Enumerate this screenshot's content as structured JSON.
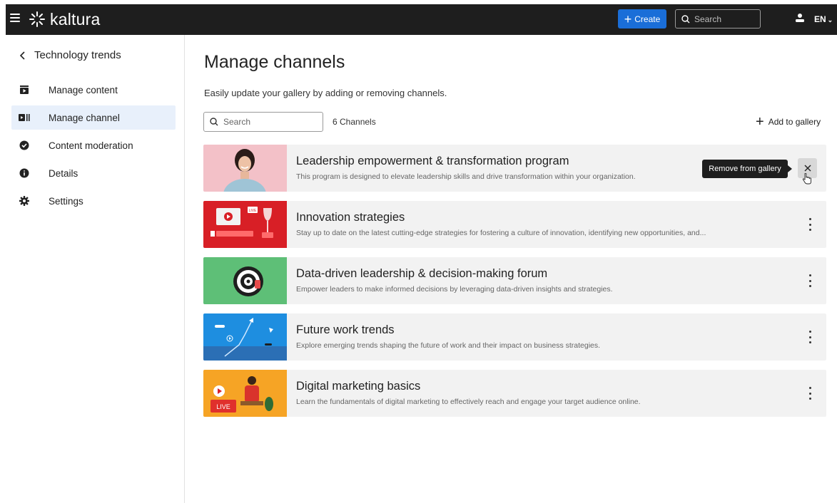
{
  "topbar": {
    "logo_text": "kaltura",
    "create_label": "Create",
    "search_placeholder": "Search",
    "language": "EN"
  },
  "sidebar": {
    "back_label": "Technology trends",
    "items": [
      {
        "label": "Manage content",
        "icon": "play-box-icon",
        "active": false
      },
      {
        "label": "Manage channel",
        "icon": "channel-icon",
        "active": true
      },
      {
        "label": "Content moderation",
        "icon": "check-circle-icon",
        "active": false
      },
      {
        "label": "Details",
        "icon": "info-icon",
        "active": false
      },
      {
        "label": "Settings",
        "icon": "gear-icon",
        "active": false
      }
    ]
  },
  "main": {
    "title": "Manage channels",
    "subtitle": "Easily update your gallery by adding or removing channels.",
    "search_placeholder": "Search",
    "count_label": "6 Channels",
    "add_label": "Add to gallery",
    "tooltip": "Remove from gallery",
    "channels": [
      {
        "title": "Leadership empowerment & transformation program",
        "description": "This program is designed to elevate leadership skills and drive transformation within your organization."
      },
      {
        "title": "Innovation strategies",
        "description": "Stay up to date on the latest cutting-edge strategies for fostering a culture of innovation, identifying new opportunities, and..."
      },
      {
        "title": "Data-driven leadership & decision-making forum",
        "description": "Empower leaders to make informed decisions by leveraging data-driven insights and strategies."
      },
      {
        "title": "Future work trends",
        "description": "Explore emerging trends shaping the future of work and their impact on business strategies."
      },
      {
        "title": "Digital marketing basics",
        "description": "Learn the fundamentals of digital marketing to effectively reach and engage your target audience online."
      }
    ]
  },
  "colors": {
    "topbar": "#1e1e1e",
    "accent": "#1a6ed8",
    "active_nav": "#e8f0fb",
    "card_bg": "#f2f2f2"
  }
}
